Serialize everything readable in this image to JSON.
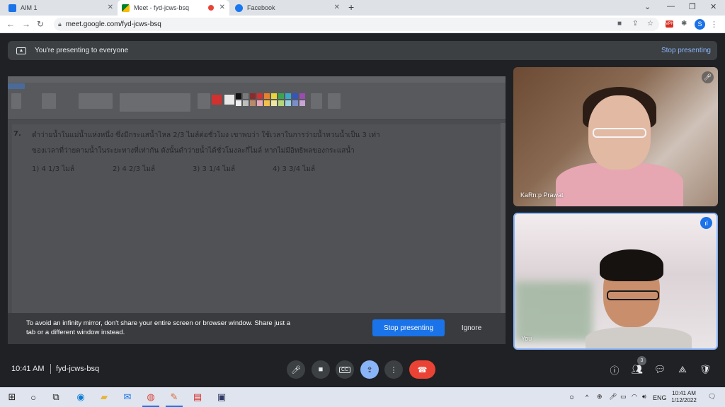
{
  "browser": {
    "tabs": [
      {
        "title": "AIM 1",
        "color": "#1a73e8"
      },
      {
        "title": "Meet - fyd-jcws-bsq",
        "color": "#00832d"
      },
      {
        "title": "Facebook",
        "color": "#1877f2"
      }
    ],
    "url": "meet.google.com/fyd-jcws-bsq",
    "profile_initial": "S",
    "ext_badge": "VPN"
  },
  "meet": {
    "banner_text": "You're presenting to everyone",
    "banner_stop": "Stop presenting",
    "warning_text": "To avoid an infinity mirror, don't share your entire screen or browser window. Share just a tab or a different window instead.",
    "stop_button": "Stop presenting",
    "ignore_button": "Ignore",
    "participants": [
      {
        "name": "KaRn:p Prawat"
      },
      {
        "name": "You"
      }
    ],
    "time": "10:41 AM",
    "meeting_code": "fyd-jcws-bsq",
    "people_count": "3"
  },
  "shared_screen": {
    "question_number": "7.",
    "line1": "ดำว่ายน้ำในแม่น้ำแห่งหนึ่ง ซึ่งมีกระแสน้ำไหล 2/3 ไมล์ต่อชั่วโมง เขาพบว่า ใช้เวลาในการว่ายน้ำทวนน้ำเป็น 3 เท่า",
    "line2": "ของเวลาที่ว่ายตามน้ำในระยะทางที่เท่ากัน ดังนั้นดำว่ายน้ำได้ชั่วโมงละกี่ไมล์ หากไม่มีอิทธิพลของกระแสน้ำ",
    "options": [
      "1) 4 1/3 ไมล์",
      "2) 4 2/3 ไมล์",
      "3) 3 1/4 ไมล์",
      "4) 3 3/4 ไมล์"
    ]
  },
  "taskbar": {
    "lang": "ENG",
    "time": "10:41 AM",
    "date": "1/12/2022"
  },
  "colors": {
    "accent": "#8ab4f8",
    "primary_button": "#1a73e8",
    "leave_button": "#ea4335"
  }
}
